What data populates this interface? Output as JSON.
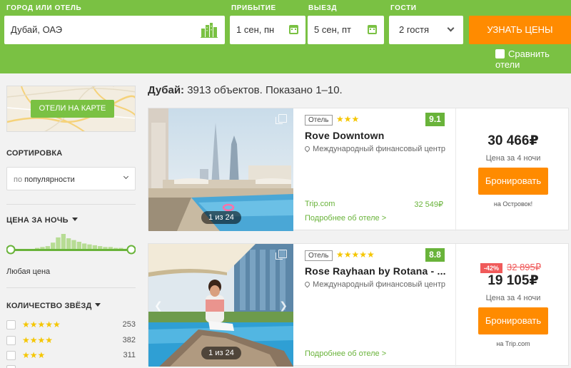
{
  "search": {
    "destination_label": "ГОРОД ИЛИ ОТЕЛЬ",
    "destination_value": "Дубай, ОАЭ",
    "checkin_label": "ПРИБЫТИЕ",
    "checkin_value": "1 сен, пн",
    "checkout_label": "ВЫЕЗД",
    "checkout_value": "5 сен, пт",
    "guests_label": "ГОСТИ",
    "guests_value": "2 гостя",
    "find_button": "УЗНАТЬ ЦЕНЫ",
    "compare_label": "Сравнить отели"
  },
  "sidebar": {
    "map_button": "ОТЕЛИ НА КАРТЕ",
    "sort_title": "СОРТИРОВКА",
    "sort_prefix": "по",
    "sort_value": "популярности",
    "price_title": "ЦЕНА ЗА НОЧЬ",
    "price_value": "Любая цена",
    "price_histogram": [
      2,
      3,
      4,
      8,
      14,
      18,
      13,
      11,
      9,
      7,
      6,
      5,
      4,
      3,
      3,
      2,
      2,
      1
    ],
    "stars_title": "КОЛИЧЕСТВО ЗВЁЗД",
    "star_filters": [
      {
        "stars": "★★★★★",
        "count": "253"
      },
      {
        "stars": "★★★★",
        "count": "382"
      },
      {
        "stars": "★★★",
        "count": "311"
      }
    ]
  },
  "results": {
    "city": "Дубай:",
    "summary": "3913 объектов. Показано 1–10."
  },
  "hotels": [
    {
      "type": "Отель",
      "stars": "★★★",
      "rating": "9.1",
      "name": "Rove Downtown",
      "location": "Международный финансовый центр",
      "agency": "Trip.com",
      "agency_price": "32 549₽",
      "more_link": "Подробнее об отеле >",
      "photo_count": "1 из 24",
      "price": "30 466₽",
      "per_nights": "Цена за 4 ночи",
      "book_button": "Бронировать",
      "source": "на Островок!"
    },
    {
      "type": "Отель",
      "stars": "★★★★★",
      "rating": "8.8",
      "name": "Rose Rayhaan by Rotana - ...",
      "location": "Международный финансовый центр",
      "more_link": "Подробнее об отеле >",
      "photo_count": "1 из 24",
      "discount": "-42%",
      "old_price": "32 895₽",
      "price": "19 105₽",
      "per_nights": "Цена за 4 ночи",
      "book_button": "Бронировать",
      "source": "на Trip.com"
    }
  ],
  "colors": {
    "brand_green": "#7ac143",
    "accent_orange": "#ff8b00",
    "rating_green": "#69b33a",
    "discount_red": "#f05a5a",
    "star_yellow": "#f5c600"
  },
  "icons": {
    "destination": "city-icon",
    "dates": "calendar-icon",
    "guests": "chevron-down-icon",
    "gallery": "gallery-icon",
    "location": "pin-icon"
  }
}
